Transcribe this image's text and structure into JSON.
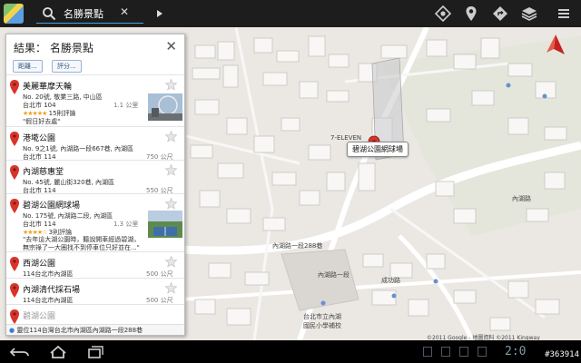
{
  "search": {
    "query": "名勝景點"
  },
  "panel": {
    "title": "結果： 名勝景點",
    "filters": [
      "距離...",
      "評分..."
    ],
    "results": [
      {
        "name": "美麗華摩天輪",
        "address": "No. 20號, 敬業三路, 中山區",
        "city": "台北市 104",
        "distance": "1.1 公里",
        "reviews": "15則評論",
        "quote": "\"假日好去處\""
      },
      {
        "name": "港墘公園",
        "address": "No. 9之1號, 內湖路一段667巷, 內湖區",
        "city": "台北市 114",
        "distance": "750 公尺"
      },
      {
        "name": "內湖慈惠堂",
        "address": "No. 45號, 麗山街320巷, 內湖區",
        "city": "台北市 114",
        "distance": "550 公尺"
      },
      {
        "name": "碧湖公園網球場",
        "address": "No. 175號, 內湖路二段, 內湖區",
        "city": "台北市 114",
        "distance": "1.3 公里",
        "reviews": "3則評論",
        "quote": "\"去年這大湖公園時，聽說開車經過碧湖，無宗祿了一大圈找不到停車位只好並在...\""
      },
      {
        "name": "西湖公園",
        "city": "114台北市內湖區",
        "distance": "500 公尺"
      },
      {
        "name": "內湖清代採石場",
        "city": "114台北市內湖區",
        "distance": "500 公尺"
      },
      {
        "name": "碧湖公園"
      }
    ],
    "address_bar": "靈位114台灣台北市內湖區內湖路一段288巷"
  },
  "map": {
    "callout": "碧湖公園網球場",
    "labels": {
      "seven": "7-ELEVEN",
      "neihu_rd": "內湖路",
      "rd1": "內湖路一段288巷",
      "rd2": "內湖路一段",
      "rd3": "成功路",
      "school1": "台北市立內湖",
      "school2": "國民小學補校"
    }
  },
  "footer": {
    "copyright": "©2011 Google - 地圖資料 ©2011 Kingway",
    "clock": "2:0",
    "watermark": "#363914"
  },
  "colors": {
    "pin": "#d9342b",
    "accent": "#4aa3df"
  }
}
